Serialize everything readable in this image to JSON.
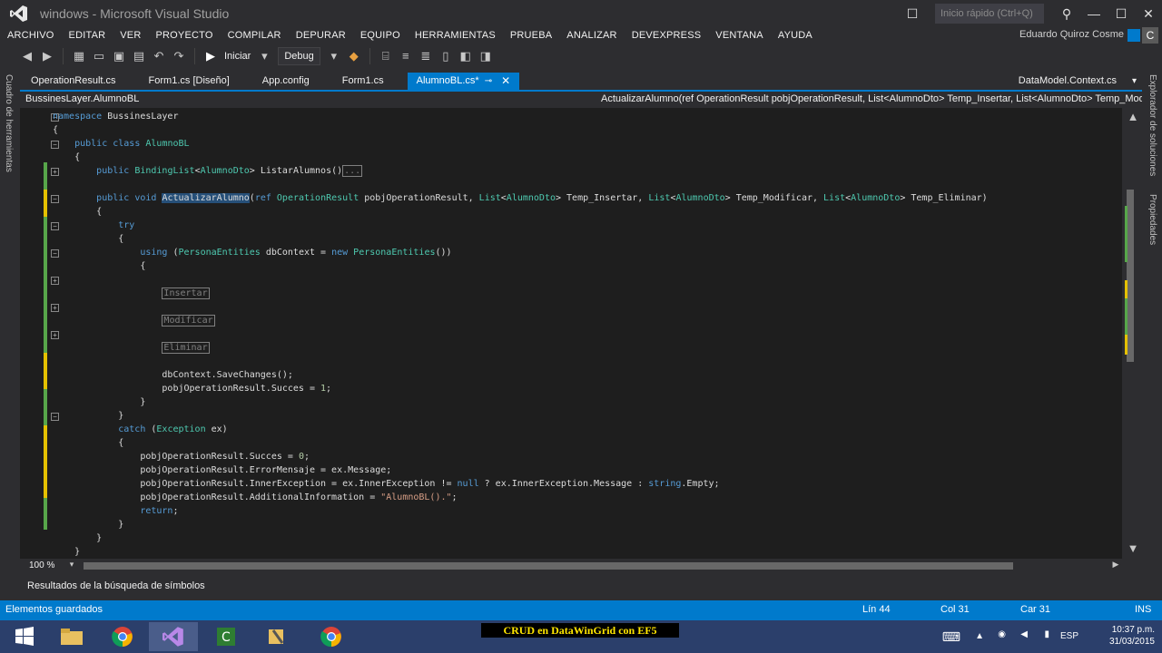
{
  "window": {
    "title": "windows - Microsoft Visual Studio",
    "quick_launch_placeholder": "Inicio rápido (Ctrl+Q)"
  },
  "menu": {
    "items": [
      "ARCHIVO",
      "EDITAR",
      "VER",
      "PROYECTO",
      "COMPILAR",
      "DEPURAR",
      "EQUIPO",
      "HERRAMIENTAS",
      "PRUEBA",
      "ANALIZAR",
      "DEVEXPRESS",
      "VENTANA",
      "AYUDA"
    ],
    "user": "Eduardo Quiroz Cosme",
    "avatar": "C"
  },
  "toolbar": {
    "start_label": "Iniciar",
    "config": "Debug"
  },
  "rails": {
    "left": "Cuadro de herramientas",
    "right_top": "Explorador de soluciones",
    "right_bottom": "Propiedades"
  },
  "tabs": {
    "items": [
      "OperationResult.cs",
      "Form1.cs [Diseño]",
      "App.config",
      "Form1.cs"
    ],
    "active": "AlumnoBL.cs*",
    "right": "DataModel.Context.cs"
  },
  "nav": {
    "class_path": "BussinesLayer.AlumnoBL",
    "member": "ActualizarAlumno(ref OperationResult pobjOperationResult, List<AlumnoDto> Temp_Insertar, List<AlumnoDto> Temp_Modificar, List<AlumnoDto> Temp_Eliminar)"
  },
  "zoom": "100 %",
  "panel": {
    "title": "Resultados de la búsqueda de símbolos"
  },
  "status": {
    "message": "Elementos guardados",
    "line": "Lín 44",
    "col": "Col 31",
    "car": "Car 31",
    "mode": "INS"
  },
  "taskbar": {
    "lang": "ESP",
    "time": "10:37 p.m.",
    "date": "31/03/2015",
    "caption": "CRUD en DataWinGrid con EF5"
  },
  "colors": {
    "accent": "#007acc",
    "change_green": "#57a64a",
    "change_yellow": "#e5c100"
  }
}
